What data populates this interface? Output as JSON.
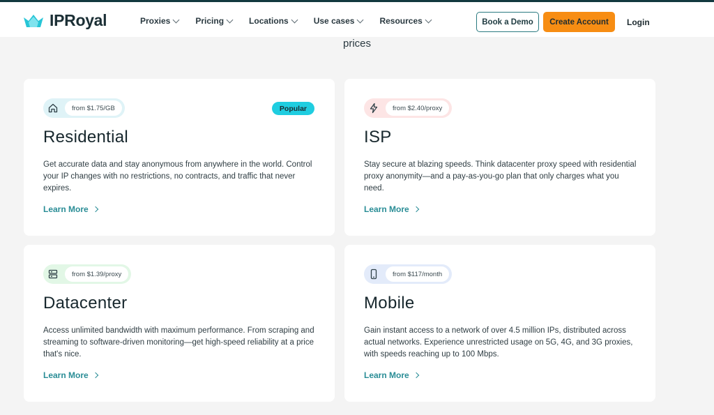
{
  "brand": {
    "name": "IPRoyal",
    "color": "#27c5d6"
  },
  "nav": {
    "items": [
      {
        "label": "Proxies"
      },
      {
        "label": "Pricing"
      },
      {
        "label": "Locations"
      },
      {
        "label": "Use cases"
      },
      {
        "label": "Resources"
      }
    ],
    "book_demo": "Book a Demo",
    "create_account": "Create Account",
    "login": "Login"
  },
  "section": {
    "subtitle": "prices"
  },
  "cards": [
    {
      "icon": "home-icon",
      "price": "from $1.75/GB",
      "badge": "Popular",
      "title": "Residential",
      "description": "Get accurate data and stay anonymous from anywhere in the world. Control your IP changes with no restrictions, no contracts, and traffic that never expires.",
      "link": "Learn More"
    },
    {
      "icon": "lightning-icon",
      "price": "from $2.40/proxy",
      "title": "ISP",
      "description": "Stay secure at blazing speeds. Think datacenter proxy speed with residential proxy anonymity—and a pay-as-you-go plan that only charges what you need.",
      "link": "Learn More"
    },
    {
      "icon": "server-icon",
      "price": "from $1.39/proxy",
      "title": "Datacenter",
      "description": "Access unlimited bandwidth with maximum performance. From scraping and streaming to software-driven monitoring—get high-speed reliability at a price that's nice.",
      "link": "Learn More"
    },
    {
      "icon": "smartphone-icon",
      "price": "from $117/month",
      "title": "Mobile",
      "description": "Gain instant access to a network of over 4.5 million IPs, distributed across actual networks. Experience unrestricted usage on 5G, 4G, and 3G proxies, with speeds reaching up to 100 Mbps.",
      "link": "Learn More"
    }
  ],
  "colors": {
    "accent_orange": "#f78d13",
    "link_teal": "#2a8d96",
    "popular_badge": "#1fcde0"
  }
}
